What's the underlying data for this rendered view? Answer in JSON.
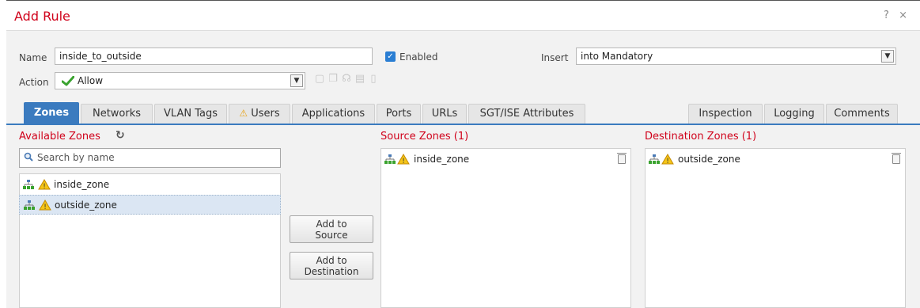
{
  "dialog": {
    "title": "Add Rule",
    "help_label": "?",
    "close_label": "×"
  },
  "form": {
    "name_label": "Name",
    "name_value": "inside_to_outside",
    "enabled_label": "Enabled",
    "insert_label": "Insert",
    "insert_value": "into Mandatory",
    "action_label": "Action",
    "action_value": "Allow"
  },
  "tabs": [
    {
      "label": "Zones",
      "active": true
    },
    {
      "label": "Networks"
    },
    {
      "label": "VLAN Tags"
    },
    {
      "label": "Users",
      "warning": true
    },
    {
      "label": "Applications"
    },
    {
      "label": "Ports"
    },
    {
      "label": "URLs"
    },
    {
      "label": "SGT/ISE Attributes"
    },
    {
      "label": "Inspection"
    },
    {
      "label": "Logging"
    },
    {
      "label": "Comments"
    }
  ],
  "available": {
    "title": "Available Zones",
    "search_placeholder": "Search by name",
    "items": [
      "inside_zone",
      "outside_zone"
    ]
  },
  "buttons": {
    "add_source": "Add to Source",
    "add_destination": "Add to Destination"
  },
  "source": {
    "title": "Source Zones (1)",
    "items": [
      "inside_zone"
    ]
  },
  "destination": {
    "title": "Destination Zones (1)",
    "items": [
      "outside_zone"
    ]
  },
  "colors": {
    "accent": "#3b7bbf",
    "title_red": "#d0021b",
    "warning": "#e8a317",
    "allow_green": "#3aa32f"
  }
}
